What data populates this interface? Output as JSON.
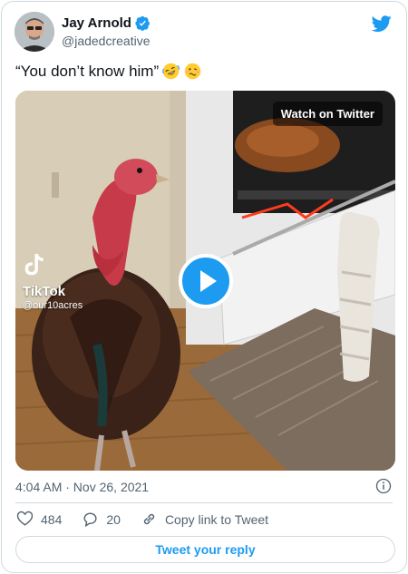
{
  "author": {
    "display_name": "Jay Arnold",
    "handle": "@jadedcreative"
  },
  "tweet": {
    "text": "“You don’t know him”",
    "emojis": [
      "rolling-on-floor-laughing",
      "woozy-face"
    ]
  },
  "media": {
    "watch_label": "Watch on Twitter",
    "tiktok_brand": "TikTok",
    "tiktok_handle": "@our10acres"
  },
  "meta": {
    "timestamp": "4:04 AM · Nov 26, 2021"
  },
  "actions": {
    "likes": "484",
    "replies": "20",
    "copy_link_label": "Copy link to Tweet",
    "reply_button_label": "Tweet your reply"
  },
  "colors": {
    "accent": "#1d9bf0",
    "secondary_text": "#536471",
    "border": "#cfd9de"
  },
  "icons": [
    "twitter-bird-icon",
    "verified-badge-icon",
    "play-icon",
    "tiktok-icon",
    "info-icon",
    "heart-icon",
    "reply-icon",
    "link-icon"
  ]
}
